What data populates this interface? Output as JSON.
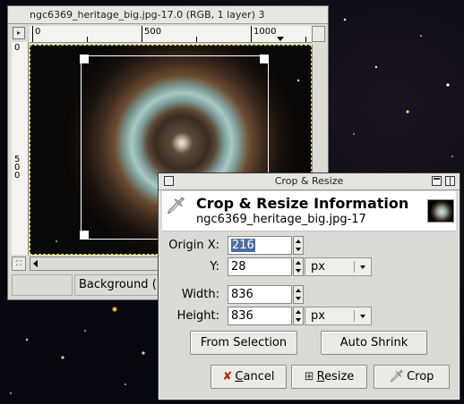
{
  "image_window": {
    "title": "ngc6369_heritage_big.jpg-17.0 (RGB, 1 layer) 3",
    "ruler_h_labels": [
      "0",
      "500",
      "1000"
    ],
    "ruler_v_labels": [
      "0",
      "5\n0\n0"
    ],
    "status_layer": "Background (",
    "menu_button_glyph": "▸",
    "zoom_toggle_glyph": "⛶"
  },
  "crop_dialog": {
    "title": "Crop & Resize",
    "info_title": "Crop & Resize Information",
    "info_subtitle": "ngc6369_heritage_big.jpg-17",
    "tool_icon": "knife-icon",
    "origin_x_label": "Origin X:",
    "origin_x_value": "216",
    "y_label": "Y:",
    "y_value": "28",
    "origin_unit": "px",
    "width_label": "Width:",
    "width_value": "836",
    "height_label": "Height:",
    "height_value": "836",
    "size_unit": "px",
    "from_selection_label": "From Selection",
    "auto_shrink_label": "Auto Shrink",
    "cancel_label_hotkey": "C",
    "cancel_label_rest": "ancel",
    "resize_label_hotkey": "R",
    "resize_label_rest": "esize",
    "crop_label": "Crop"
  },
  "colors": {
    "selection_highlight": "#4a6ea0",
    "cancel_icon": "#c0201a",
    "marching_ants": "#ffee00"
  }
}
